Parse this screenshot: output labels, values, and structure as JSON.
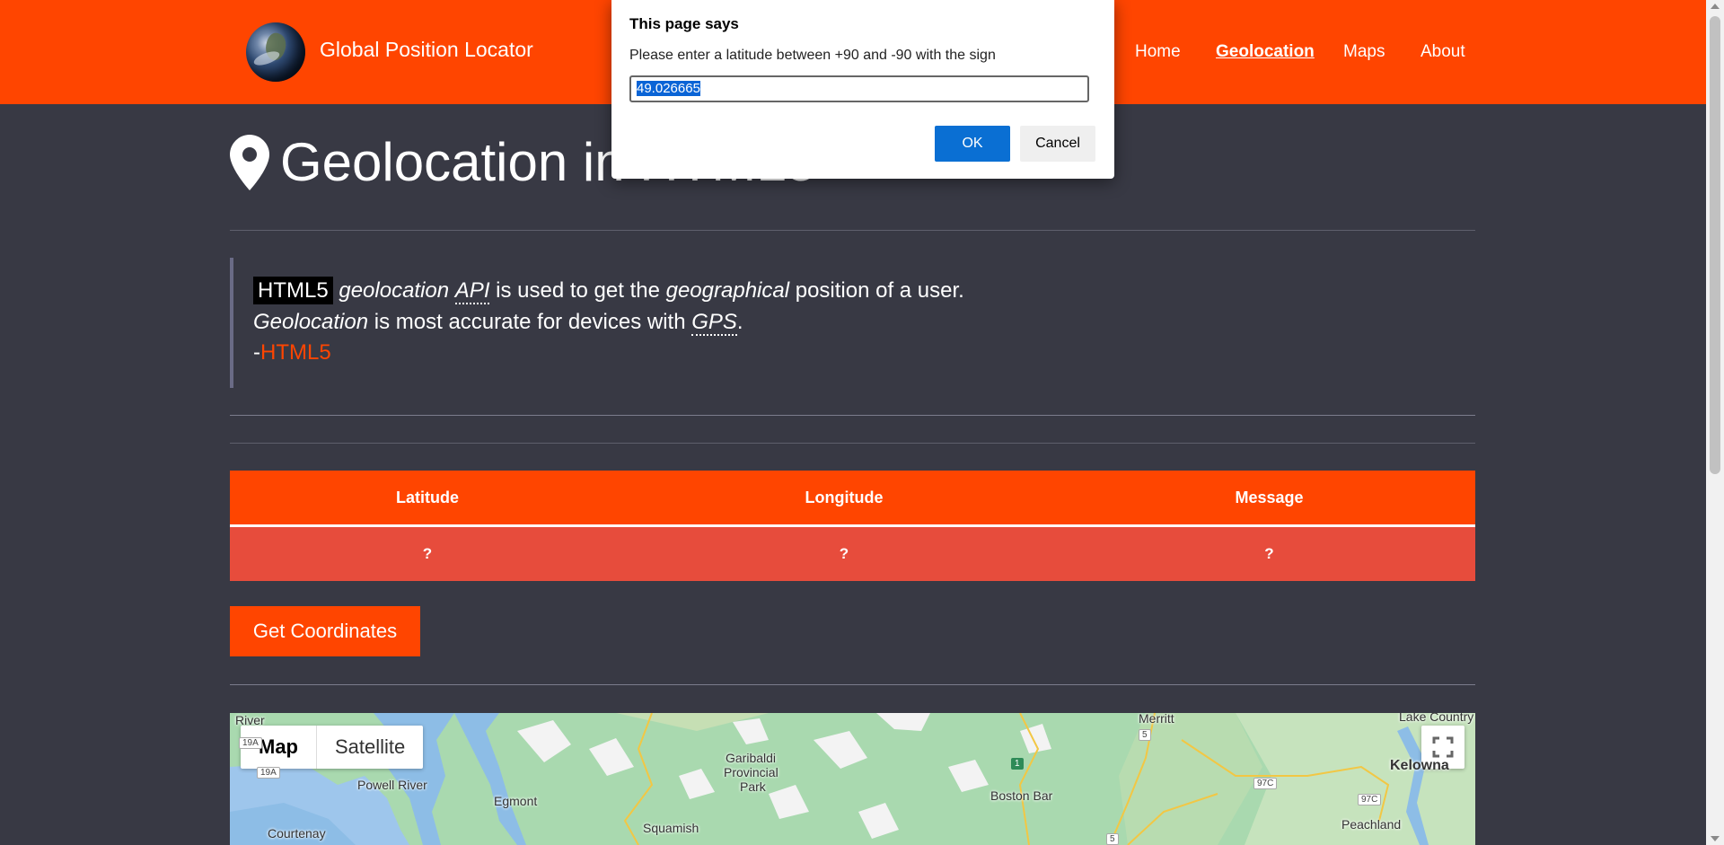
{
  "header": {
    "brand": "Global Position Locator",
    "nav": [
      "Home",
      "Geolocation",
      "Maps",
      "About"
    ],
    "active": "Geolocation"
  },
  "page": {
    "title": "Geolocation in HTML5",
    "quote": {
      "badge": "HTML5",
      "line1_a": "geolocation",
      "line1_b": "API",
      "line1_c": " is used to get the ",
      "line1_d": "geographical",
      "line1_e": " position of a user.",
      "line2_a": "Geolocation",
      "line2_b": " is most accurate for devices with ",
      "line2_c": "GPS",
      "line2_d": ".",
      "line3_a": "-",
      "line3_b": "HTML5"
    }
  },
  "table": {
    "headers": [
      "Latitude",
      "Longitude",
      "Message"
    ],
    "row": [
      "?",
      "?",
      "?"
    ]
  },
  "button": {
    "get": "Get Coordinates"
  },
  "map": {
    "types": [
      "Map",
      "Satellite"
    ],
    "places": [
      "Powell River",
      "Egmont",
      "Garibaldi",
      "Provincial",
      "Park",
      "Squamish",
      "Courtenay",
      "Boston Bar",
      "Merritt",
      "Lake Country",
      "Kelowna",
      "Peachland",
      "River"
    ],
    "roads": [
      "19A",
      "19A",
      "5",
      "97C",
      "97C",
      "5",
      "1"
    ]
  },
  "dialog": {
    "title": "This page says",
    "message": "Please enter a latitude between +90 and -90 with the sign",
    "value": "49.026665",
    "ok": "OK",
    "cancel": "Cancel"
  },
  "colors": {
    "accent": "#ff4500",
    "row": "#e74c3c",
    "bg": "#383944"
  }
}
